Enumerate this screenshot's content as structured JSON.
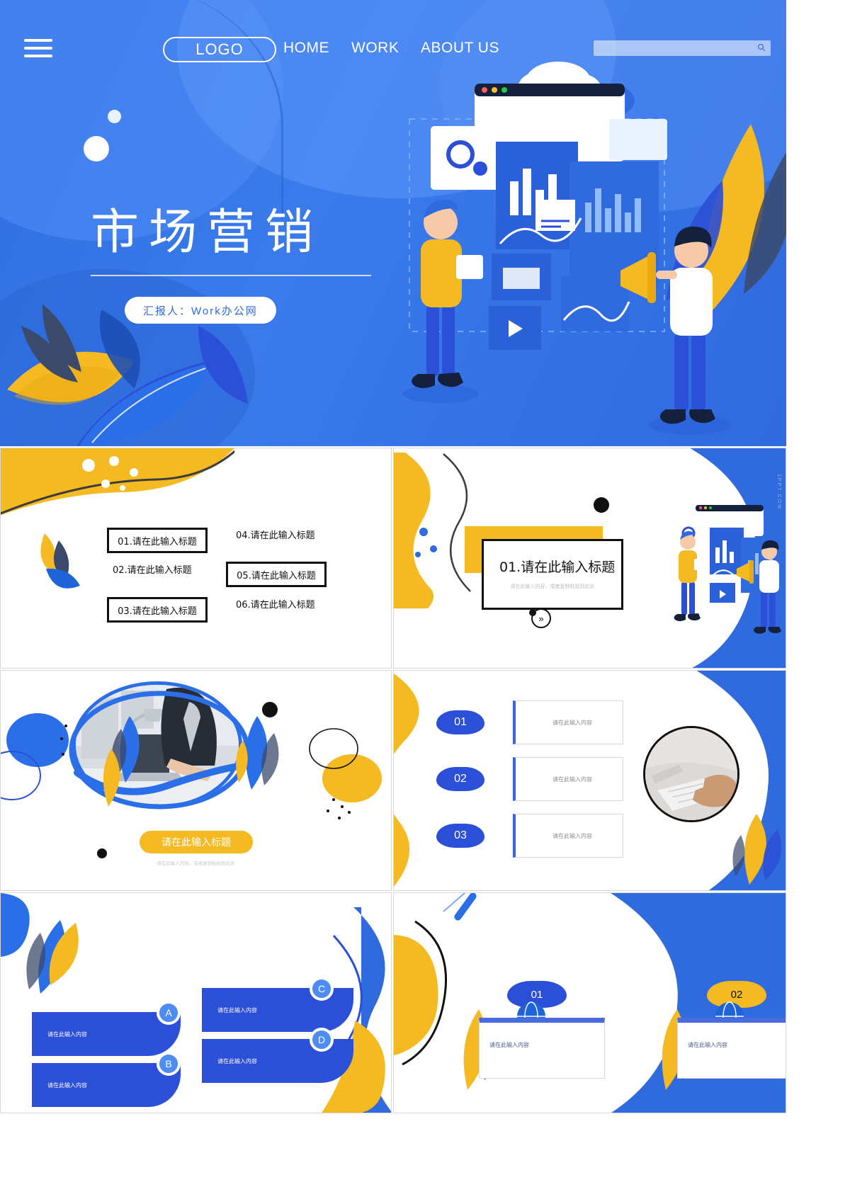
{
  "hero": {
    "logo": "LOGO",
    "nav": [
      {
        "label": "HOME"
      },
      {
        "label": "WORK"
      },
      {
        "label": "ABOUT US"
      }
    ],
    "search_placeholder": "",
    "title": "市场营销",
    "presenter_pill": "汇报人：Work办公网",
    "menu_icon": "hamburger-menu-icon",
    "search_icon": "search-icon"
  },
  "slide_contents": {
    "title_placeholder": "请在此输入标题",
    "body_placeholder": "请在此输入内容",
    "long_placeholder": "请在此输入内容，或者复制粘贴到此处",
    "watermark": "1PPT.COM"
  },
  "slide2": {
    "items": [
      {
        "num": "01.",
        "text": "请在此输入标题",
        "boxed": true
      },
      {
        "num": "02.",
        "text": "请在此输入标题",
        "boxed": false
      },
      {
        "num": "03.",
        "text": "请在此输入标题",
        "boxed": true
      },
      {
        "num": "04.",
        "text": "请在此输入标题",
        "boxed": false
      },
      {
        "num": "05.",
        "text": "请在此输入标题",
        "boxed": true
      },
      {
        "num": "06.",
        "text": "请在此输入标题",
        "boxed": false
      }
    ]
  },
  "slide3": {
    "heading": "01.请在此输入标题",
    "sub": "请在此输入内容，或者复制粘贴到此处",
    "arrow": "»",
    "watermark": "1PPT.COM"
  },
  "slide4": {
    "pill_label": "请在此输入标题",
    "caption": "请在此输入内容，或者复制粘贴到此处"
  },
  "slide5": {
    "rows": [
      {
        "num": "01",
        "text": "请在此输入内容"
      },
      {
        "num": "02",
        "text": "请在此输入内容"
      },
      {
        "num": "03",
        "text": "请在此输入内容"
      }
    ]
  },
  "slide6": {
    "items": [
      {
        "badge": "A",
        "text": "请在此输入内容"
      },
      {
        "badge": "B",
        "text": "请在此输入内容"
      },
      {
        "badge": "C",
        "text": "请在此输入内容"
      },
      {
        "badge": "D",
        "text": "请在此输入内容"
      }
    ]
  },
  "slide7": {
    "items": [
      {
        "num": "01",
        "text": "请在此输入内容"
      },
      {
        "num": "02",
        "text": "请在此输入内容"
      }
    ]
  },
  "colors": {
    "brand_blue": "#2f6ade",
    "deep_blue": "#2B4FD6",
    "light_blue": "#4D8CF0",
    "yellow": "#F5B921",
    "dark_navy": "#3b4a6b",
    "black": "#111111"
  }
}
